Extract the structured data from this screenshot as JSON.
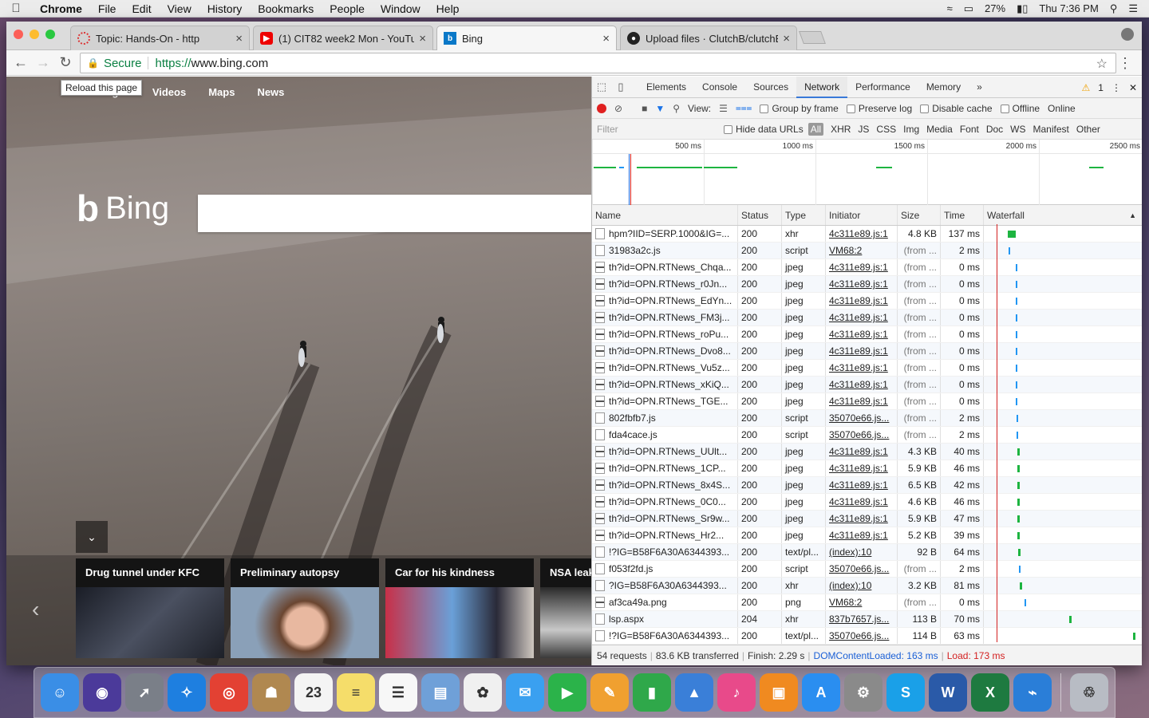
{
  "menubar": {
    "app": "Chrome",
    "items": [
      "File",
      "Edit",
      "View",
      "History",
      "Bookmarks",
      "People",
      "Window",
      "Help"
    ],
    "battery": "27%",
    "clock": "Thu 7:36 PM"
  },
  "tabs": [
    {
      "title": "Topic: Hands-On - http",
      "favicon_color": "#d33"
    },
    {
      "title": "(1) CIT82 week2 Mon - YouTub",
      "favicon_color": "#e00"
    },
    {
      "title": "Bing",
      "favicon_color": "#0a78c8"
    },
    {
      "title": "Upload files · ClutchB/clutchB",
      "favicon_color": "#222"
    }
  ],
  "toolbar": {
    "secure": "Secure",
    "url_scheme": "https://",
    "url_host": "www.bing.com",
    "tooltip": "Reload this page"
  },
  "bing": {
    "nav": [
      "Images",
      "Videos",
      "Maps",
      "News"
    ],
    "logo_text": "Bing",
    "cards": [
      {
        "title": "Drug tunnel under KFC"
      },
      {
        "title": "Preliminary autopsy"
      },
      {
        "title": "Car for his kindness"
      },
      {
        "title": "NSA leak"
      }
    ]
  },
  "devtools": {
    "tabs": [
      "Elements",
      "Console",
      "Sources",
      "Network",
      "Performance",
      "Memory"
    ],
    "active_tab": "Network",
    "warning_count": "1",
    "bar": {
      "view": "View:",
      "group_by_frame": "Group by frame",
      "preserve_log": "Preserve log",
      "disable_cache": "Disable cache",
      "offline": "Offline",
      "throttle": "Online"
    },
    "filter": {
      "placeholder": "Filter",
      "hide_data_urls": "Hide data URLs",
      "types": [
        "All",
        "XHR",
        "JS",
        "CSS",
        "Img",
        "Media",
        "Font",
        "Doc",
        "WS",
        "Manifest",
        "Other"
      ]
    },
    "overview_ticks": [
      "500 ms",
      "1000 ms",
      "1500 ms",
      "2000 ms",
      "2500 ms"
    ],
    "columns": [
      "Name",
      "Status",
      "Type",
      "Initiator",
      "Size",
      "Time",
      "Waterfall"
    ],
    "rows": [
      {
        "name": "hpm?IID=SERP.1000&IG=...",
        "status": "200",
        "type": "xhr",
        "initiator": "4c311e89.js:1",
        "size": "4.8 KB",
        "time": "137 ms",
        "wf": 0.16,
        "ww": 0.05,
        "wc": "#1db440"
      },
      {
        "name": "31983a2c.js",
        "status": "200",
        "type": "script",
        "initiator": "VM68:2",
        "size": "(from ...",
        "time": "2 ms",
        "wf": 0.165,
        "ww": 0.006,
        "wc": "#2196f3"
      },
      {
        "name": "th?id=OPN.RTNews_Chqa...",
        "status": "200",
        "type": "jpeg",
        "initiator": "4c311e89.js:1",
        "size": "(from ...",
        "time": "0 ms",
        "wf": 0.21,
        "ww": 0.006,
        "wc": "#2196f3"
      },
      {
        "name": "th?id=OPN.RTNews_r0Jn...",
        "status": "200",
        "type": "jpeg",
        "initiator": "4c311e89.js:1",
        "size": "(from ...",
        "time": "0 ms",
        "wf": 0.21,
        "ww": 0.006,
        "wc": "#2196f3"
      },
      {
        "name": "th?id=OPN.RTNews_EdYn...",
        "status": "200",
        "type": "jpeg",
        "initiator": "4c311e89.js:1",
        "size": "(from ...",
        "time": "0 ms",
        "wf": 0.21,
        "ww": 0.006,
        "wc": "#2196f3"
      },
      {
        "name": "th?id=OPN.RTNews_FM3j...",
        "status": "200",
        "type": "jpeg",
        "initiator": "4c311e89.js:1",
        "size": "(from ...",
        "time": "0 ms",
        "wf": 0.21,
        "ww": 0.006,
        "wc": "#2196f3"
      },
      {
        "name": "th?id=OPN.RTNews_roPu...",
        "status": "200",
        "type": "jpeg",
        "initiator": "4c311e89.js:1",
        "size": "(from ...",
        "time": "0 ms",
        "wf": 0.21,
        "ww": 0.006,
        "wc": "#2196f3"
      },
      {
        "name": "th?id=OPN.RTNews_Dvo8...",
        "status": "200",
        "type": "jpeg",
        "initiator": "4c311e89.js:1",
        "size": "(from ...",
        "time": "0 ms",
        "wf": 0.21,
        "ww": 0.006,
        "wc": "#2196f3"
      },
      {
        "name": "th?id=OPN.RTNews_Vu5z...",
        "status": "200",
        "type": "jpeg",
        "initiator": "4c311e89.js:1",
        "size": "(from ...",
        "time": "0 ms",
        "wf": 0.21,
        "ww": 0.006,
        "wc": "#2196f3"
      },
      {
        "name": "th?id=OPN.RTNews_xKiQ...",
        "status": "200",
        "type": "jpeg",
        "initiator": "4c311e89.js:1",
        "size": "(from ...",
        "time": "0 ms",
        "wf": 0.21,
        "ww": 0.006,
        "wc": "#2196f3"
      },
      {
        "name": "th?id=OPN.RTNews_TGE...",
        "status": "200",
        "type": "jpeg",
        "initiator": "4c311e89.js:1",
        "size": "(from ...",
        "time": "0 ms",
        "wf": 0.21,
        "ww": 0.006,
        "wc": "#2196f3"
      },
      {
        "name": "802fbfb7.js",
        "status": "200",
        "type": "script",
        "initiator": "35070e66.js...",
        "size": "(from ...",
        "time": "2 ms",
        "wf": 0.215,
        "ww": 0.006,
        "wc": "#2196f3"
      },
      {
        "name": "fda4cace.js",
        "status": "200",
        "type": "script",
        "initiator": "35070e66.js...",
        "size": "(from ...",
        "time": "2 ms",
        "wf": 0.215,
        "ww": 0.006,
        "wc": "#2196f3"
      },
      {
        "name": "th?id=OPN.RTNews_UUlt...",
        "status": "200",
        "type": "jpeg",
        "initiator": "4c311e89.js:1",
        "size": "4.3 KB",
        "time": "40 ms",
        "wf": 0.22,
        "ww": 0.014,
        "wc": "#1db440"
      },
      {
        "name": "th?id=OPN.RTNews_1CP...",
        "status": "200",
        "type": "jpeg",
        "initiator": "4c311e89.js:1",
        "size": "5.9 KB",
        "time": "46 ms",
        "wf": 0.22,
        "ww": 0.014,
        "wc": "#1db440"
      },
      {
        "name": "th?id=OPN.RTNews_8x4S...",
        "status": "200",
        "type": "jpeg",
        "initiator": "4c311e89.js:1",
        "size": "6.5 KB",
        "time": "42 ms",
        "wf": 0.22,
        "ww": 0.014,
        "wc": "#1db440"
      },
      {
        "name": "th?id=OPN.RTNews_0C0...",
        "status": "200",
        "type": "jpeg",
        "initiator": "4c311e89.js:1",
        "size": "4.6 KB",
        "time": "46 ms",
        "wf": 0.22,
        "ww": 0.014,
        "wc": "#1db440"
      },
      {
        "name": "th?id=OPN.RTNews_Sr9w...",
        "status": "200",
        "type": "jpeg",
        "initiator": "4c311e89.js:1",
        "size": "5.9 KB",
        "time": "47 ms",
        "wf": 0.22,
        "ww": 0.014,
        "wc": "#1db440"
      },
      {
        "name": "th?id=OPN.RTNews_Hr2...",
        "status": "200",
        "type": "jpeg",
        "initiator": "4c311e89.js:1",
        "size": "5.2 KB",
        "time": "39 ms",
        "wf": 0.22,
        "ww": 0.014,
        "wc": "#1db440"
      },
      {
        "name": "!?IG=B58F6A30A6344393...",
        "status": "200",
        "type": "text/pl...",
        "initiator": "(index):10",
        "size": "92 B",
        "time": "64 ms",
        "wf": 0.225,
        "ww": 0.016,
        "wc": "#1db440"
      },
      {
        "name": "f053f2fd.js",
        "status": "200",
        "type": "script",
        "initiator": "35070e66.js...",
        "size": "(from ...",
        "time": "2 ms",
        "wf": 0.23,
        "ww": 0.006,
        "wc": "#2196f3"
      },
      {
        "name": "?IG=B58F6A30A6344393...",
        "status": "200",
        "type": "xhr",
        "initiator": "(index):10",
        "size": "3.2 KB",
        "time": "81 ms",
        "wf": 0.235,
        "ww": 0.018,
        "wc": "#1db440"
      },
      {
        "name": "af3ca49a.png",
        "status": "200",
        "type": "png",
        "initiator": "VM68:2",
        "size": "(from ...",
        "time": "0 ms",
        "wf": 0.27,
        "ww": 0.006,
        "wc": "#2196f3"
      },
      {
        "name": "lsp.aspx",
        "status": "204",
        "type": "xhr",
        "initiator": "837b7657.js...",
        "size": "113 B",
        "time": "70 ms",
        "wf": 0.565,
        "ww": 0.018,
        "wc": "#1db440"
      },
      {
        "name": "!?IG=B58F6A30A6344393...",
        "status": "200",
        "type": "text/pl...",
        "initiator": "35070e66.js...",
        "size": "114 B",
        "time": "63 ms",
        "wf": 0.985,
        "ww": 0.015,
        "wc": "#1db440"
      }
    ],
    "status": {
      "requests": "54 requests",
      "transferred": "83.6 KB transferred",
      "finish": "Finish: 2.29 s",
      "dcl": "DOMContentLoaded: 163 ms",
      "load": "Load: 173 ms",
      "dcl_color": "#1a5fd6",
      "load_color": "#d32020"
    }
  },
  "dock": [
    {
      "name": "finder",
      "color": "#3a8ee6",
      "glyph": "☺"
    },
    {
      "name": "siri",
      "color": "#4b3a9a",
      "glyph": "◉"
    },
    {
      "name": "launchpad",
      "color": "#7a7f88",
      "glyph": "➚"
    },
    {
      "name": "safari",
      "color": "#1e7fe0",
      "glyph": "✧"
    },
    {
      "name": "chrome",
      "color": "#e34133",
      "glyph": "◎"
    },
    {
      "name": "contacts",
      "color": "#b08850",
      "glyph": "☗"
    },
    {
      "name": "calendar",
      "color": "#f4f4f4",
      "glyph": "23"
    },
    {
      "name": "notes",
      "color": "#f5dd6a",
      "glyph": "≡"
    },
    {
      "name": "reminders",
      "color": "#f7f7f7",
      "glyph": "☰"
    },
    {
      "name": "preview",
      "color": "#6fa0d8",
      "glyph": "▤"
    },
    {
      "name": "photos",
      "color": "#f0f0f0",
      "glyph": "✿"
    },
    {
      "name": "messages",
      "color": "#3aa0f0",
      "glyph": "✉"
    },
    {
      "name": "facetime",
      "color": "#2bb34a",
      "glyph": "▶"
    },
    {
      "name": "pages",
      "color": "#f0a030",
      "glyph": "✎"
    },
    {
      "name": "numbers",
      "color": "#2fa84a",
      "glyph": "▮"
    },
    {
      "name": "keynote",
      "color": "#3a7fd8",
      "glyph": "▲"
    },
    {
      "name": "itunes",
      "color": "#e84a8a",
      "glyph": "♪"
    },
    {
      "name": "ibooks",
      "color": "#f08a20",
      "glyph": "▣"
    },
    {
      "name": "app-store",
      "color": "#2a8ef0",
      "glyph": "A"
    },
    {
      "name": "system-preferences",
      "color": "#8a8a8a",
      "glyph": "⚙"
    },
    {
      "name": "skype",
      "color": "#1aa0e8",
      "glyph": "S"
    },
    {
      "name": "word",
      "color": "#2a5aa8",
      "glyph": "W"
    },
    {
      "name": "excel",
      "color": "#1e7a40",
      "glyph": "X"
    },
    {
      "name": "xcode",
      "color": "#2a7ed8",
      "glyph": "⌁"
    },
    {
      "name": "trash",
      "color": "#b8bcc4",
      "glyph": "♲"
    }
  ]
}
